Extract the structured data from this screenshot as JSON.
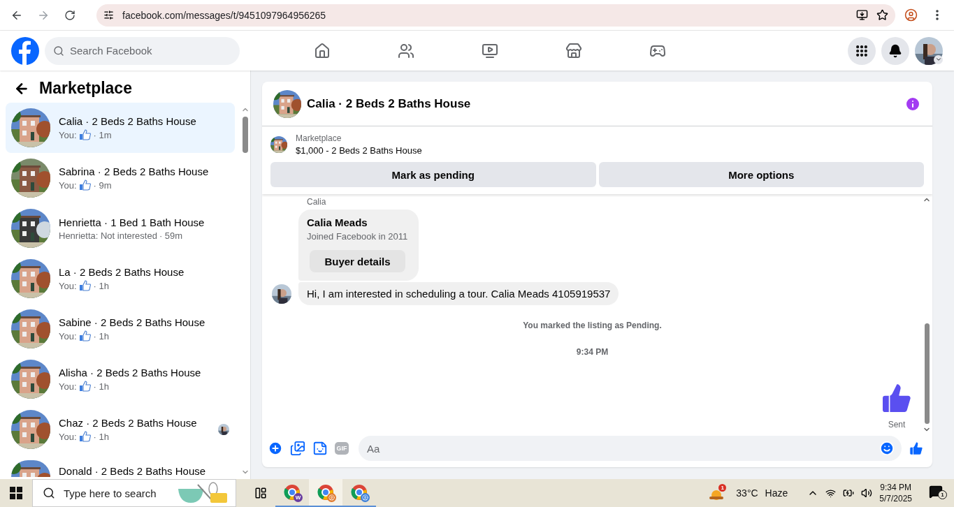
{
  "browser": {
    "url": "facebook.com/messages/t/9451097964956265"
  },
  "header": {
    "search_placeholder": "Search Facebook"
  },
  "sidebar": {
    "title": "Marketplace",
    "conversations": [
      {
        "title": "Calia · 2 Beds 2 Baths House",
        "kind": "like",
        "preview": "You:",
        "time": "· 1m",
        "selected": true,
        "seen": false
      },
      {
        "title": "Sabrina · 2 Beds 2 Baths House",
        "kind": "like",
        "preview": "You:",
        "time": "· 9m",
        "selected": false,
        "seen": false
      },
      {
        "title": "Henrietta · 1 Bed 1 Bath House",
        "kind": "text",
        "preview": "Henrietta: Not interested",
        "time": "· 59m",
        "selected": false,
        "seen": false
      },
      {
        "title": "La · 2 Beds 2 Baths House",
        "kind": "like",
        "preview": "You:",
        "time": "· 1h",
        "selected": false,
        "seen": false
      },
      {
        "title": "Sabine · 2 Beds 2 Baths House",
        "kind": "like",
        "preview": "You:",
        "time": "· 1h",
        "selected": false,
        "seen": false
      },
      {
        "title": "Alisha · 2 Beds 2 Baths House",
        "kind": "like",
        "preview": "You:",
        "time": "· 1h",
        "selected": false,
        "seen": false
      },
      {
        "title": "Chaz · 2 Beds 2 Baths House",
        "kind": "like",
        "preview": "You:",
        "time": "· 1h",
        "selected": false,
        "seen": true
      },
      {
        "title": "Donald · 2 Beds 2 Baths House",
        "kind": "title_only",
        "selected": false,
        "seen": false
      }
    ]
  },
  "chat": {
    "title": "Calia · 2 Beds 2 Baths House",
    "listing": {
      "label": "Marketplace",
      "name": "$1,000 - 2 Beds 2 Baths House"
    },
    "actions": [
      "Mark as pending",
      "More options"
    ],
    "messages": [
      {
        "kind": "sender_label",
        "text": "Calia"
      },
      {
        "kind": "profile_card",
        "name": "Calia Meads",
        "detail": "Joined Facebook in 2011",
        "button": "Buyer details"
      },
      {
        "kind": "incoming",
        "text": "Hi, I am interested in scheduling a tour. Calia Meads 4105919537"
      },
      {
        "kind": "notice",
        "text": "You marked the listing as Pending."
      },
      {
        "kind": "timestamp",
        "text": "9:34 PM"
      },
      {
        "kind": "sent_like",
        "status": "Sent"
      }
    ],
    "composer": {
      "placeholder": "Aa",
      "gif_label": "GIF"
    }
  },
  "taskbar": {
    "search_placeholder": "Type here to search",
    "apps": [
      {
        "kind": "letter",
        "badge": "W",
        "selected": false
      },
      {
        "kind": "profile",
        "selected": true
      },
      {
        "kind": "profile",
        "selected": false
      }
    ],
    "weather": {
      "badge": "1",
      "temperature": "33°C",
      "condition": "Haze"
    },
    "clock": {
      "time": "9:34 PM",
      "date": "5/7/2025"
    },
    "notifications": {
      "badge": "1"
    }
  }
}
